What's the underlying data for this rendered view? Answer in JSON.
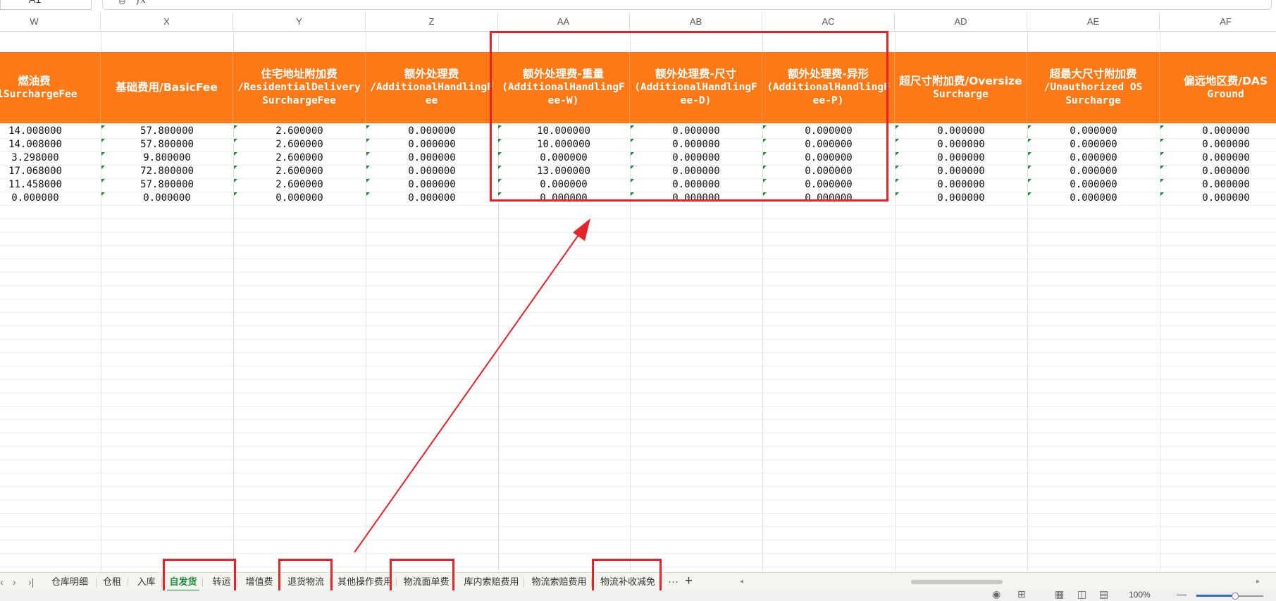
{
  "formula_bar": {
    "name_box": "A1",
    "fx_label": "fx"
  },
  "columns": [
    "W",
    "X",
    "Y",
    "Z",
    "AA",
    "AB",
    "AC",
    "AD",
    "AE",
    "AF"
  ],
  "header": [
    {
      "l1": "燃油费",
      "l2": "elSurchargeFee",
      "l3": ""
    },
    {
      "l1": "基础费用/BasicFee",
      "l2": "",
      "l3": ""
    },
    {
      "l1": "住宅地址附加费",
      "l2": "/ResidentialDelivery",
      "l3": "SurchargeFee"
    },
    {
      "l1": "额外处理费",
      "l2": "/AdditionalHandlingF",
      "l3": "ee"
    },
    {
      "l1": "额外处理费-重量",
      "l2": "(AdditionalHandlingF",
      "l3": "ee-W)"
    },
    {
      "l1": "额外处理费-尺寸",
      "l2": "(AdditionalHandlingF",
      "l3": "ee-D)"
    },
    {
      "l1": "额外处理费-异形",
      "l2": "(AdditionalHandlingF",
      "l3": "ee-P)"
    },
    {
      "l1": "超尺寸附加费/Oversize",
      "l2": "Surcharge",
      "l3": ""
    },
    {
      "l1": "超最大尺寸附加费",
      "l2": "/Unauthorized OS",
      "l3": "Surcharge"
    },
    {
      "l1": "偏远地区费/DAS",
      "l2": "Ground",
      "l3": ""
    }
  ],
  "rows": [
    [
      "14.008000",
      "57.800000",
      "2.600000",
      "0.000000",
      "10.000000",
      "0.000000",
      "0.000000",
      "0.000000",
      "0.000000",
      "0.000000"
    ],
    [
      "14.008000",
      "57.800000",
      "2.600000",
      "0.000000",
      "10.000000",
      "0.000000",
      "0.000000",
      "0.000000",
      "0.000000",
      "0.000000"
    ],
    [
      "3.298000",
      "9.800000",
      "2.600000",
      "0.000000",
      "0.000000",
      "0.000000",
      "0.000000",
      "0.000000",
      "0.000000",
      "0.000000"
    ],
    [
      "17.068000",
      "72.800000",
      "2.600000",
      "0.000000",
      "13.000000",
      "0.000000",
      "0.000000",
      "0.000000",
      "0.000000",
      "0.000000"
    ],
    [
      "11.458000",
      "57.800000",
      "2.600000",
      "0.000000",
      "0.000000",
      "0.000000",
      "0.000000",
      "0.000000",
      "0.000000",
      "0.000000"
    ],
    [
      "0.000000",
      "0.000000",
      "0.000000",
      "0.000000",
      "0.000000",
      "0.000000",
      "0.000000",
      "0.000000",
      "0.000000",
      "0.000000"
    ]
  ],
  "sheet_tabs": {
    "nav": [
      "‹",
      "›",
      "›|"
    ],
    "tabs": [
      "仓库明细",
      "仓租",
      "入库",
      "自发货",
      "转运",
      "增值费",
      "退货物流",
      "其他操作费用",
      "物流面单费",
      "库内索赔费用",
      "物流索赔费用",
      "物流补收减免"
    ],
    "active_tab": "自发货",
    "more": "···",
    "add": "+"
  },
  "status_bar": {
    "zoom": "100%",
    "zoom_fraction": 0.59
  },
  "colors": {
    "header_bg": "#ff7a16",
    "annotation_red": "#e3242b",
    "active_tab_green": "#1e8a3a"
  }
}
